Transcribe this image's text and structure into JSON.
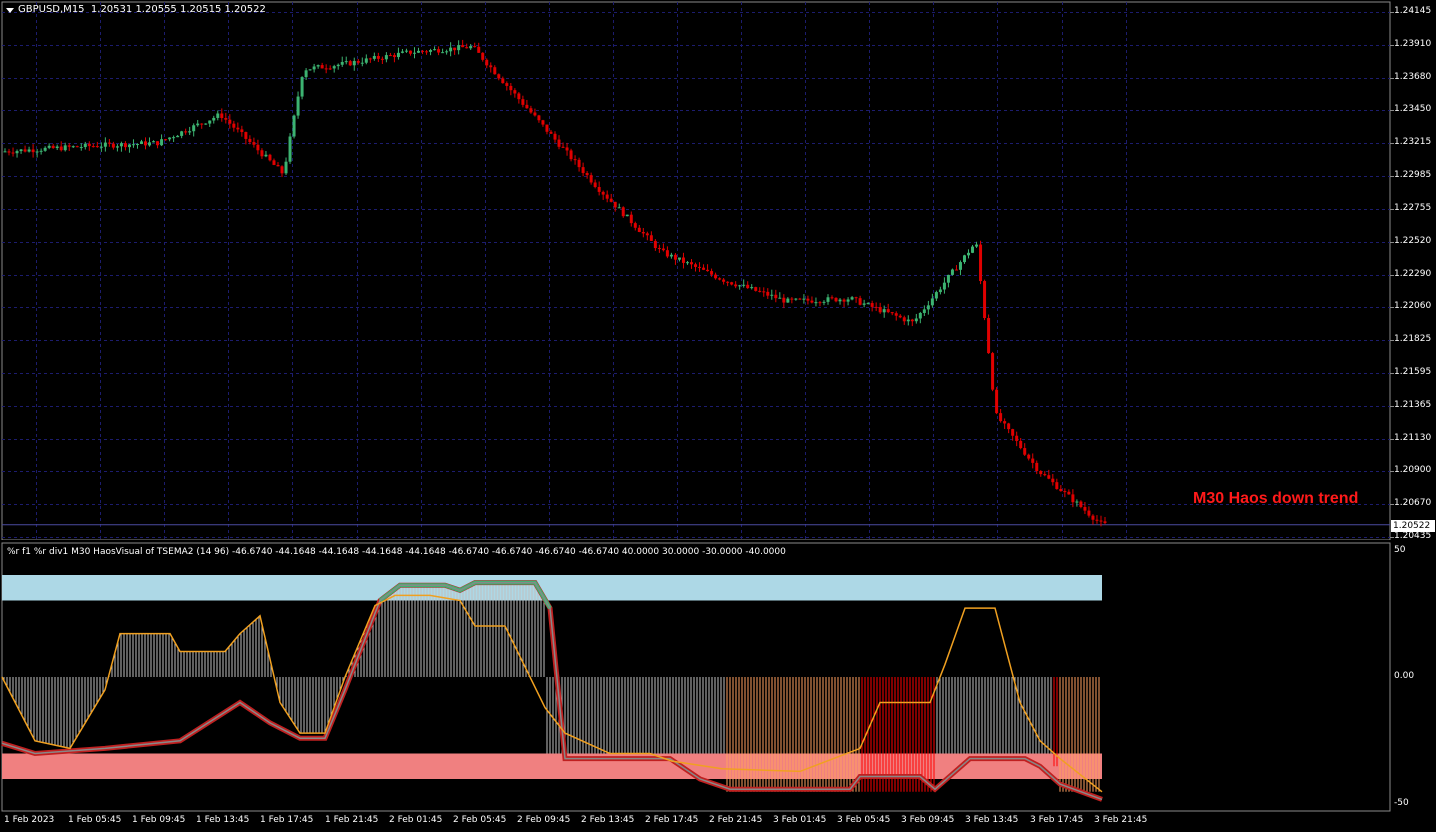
{
  "main_title": {
    "symbol": "GBPUSD,M15",
    "ohlc": "1.20531 1.20555 1.20515 1.20522"
  },
  "indicator_title": "%r f1 %r div1 M30 HaosVisual of TSEMA2 (14 96) -46.6740 -44.1648 -44.1648 -44.1648 -44.1648 -46.6740 -46.6740 -46.6740 -46.6740 40.0000 30.0000 -30.0000 -40.0000",
  "annotation": "M30 Haos down trend",
  "current_price": "1.20522",
  "price_axis": [
    "1.24145",
    "1.23910",
    "1.23680",
    "1.23450",
    "1.23215",
    "1.22985",
    "1.22755",
    "1.22520",
    "1.22290",
    "1.22060",
    "1.21825",
    "1.21595",
    "1.21365",
    "1.21130",
    "1.20900",
    "1.20670",
    "1.20435"
  ],
  "indicator_axis": [
    "50",
    "0.00",
    "-50"
  ],
  "time_axis": [
    "1 Feb 2023",
    "1 Feb 05:45",
    "1 Feb 09:45",
    "1 Feb 13:45",
    "1 Feb 17:45",
    "1 Feb 21:45",
    "2 Feb 01:45",
    "2 Feb 05:45",
    "2 Feb 09:45",
    "2 Feb 13:45",
    "2 Feb 17:45",
    "2 Feb 21:45",
    "3 Feb 01:45",
    "3 Feb 05:45",
    "3 Feb 09:45",
    "3 Feb 13:45",
    "3 Feb 17:45",
    "3 Feb 21:45"
  ],
  "colors": {
    "background": "#000000",
    "grid": "#1c1c6e",
    "bull_candle": "#3cb371",
    "bear_candle": "#e00000",
    "upper_band": "#add8e6",
    "lower_band": "#f08080",
    "histogram_neutral": "#c0c0c0",
    "histogram_orange": "#ffa060",
    "histogram_red": "#ff0000",
    "line_orange": "#f0a020",
    "line_green": "#3cb371",
    "line_dark_red": "#c02020"
  },
  "chart_data": {
    "type": "candlestick",
    "symbol": "GBPUSD",
    "timeframe": "M15",
    "y_range": [
      1.20435,
      1.24145
    ],
    "price_path_keypoints": [
      [
        "1 Feb 00:00",
        1.2316
      ],
      [
        "1 Feb 05:45",
        1.232
      ],
      [
        "1 Feb 09:45",
        1.2322
      ],
      [
        "1 Feb 13:45",
        1.2342
      ],
      [
        "1 Feb 17:45",
        1.23
      ],
      [
        "1 Feb 19:00",
        1.2374
      ],
      [
        "1 Feb 21:45",
        1.2378
      ],
      [
        "2 Feb 01:45",
        1.2386
      ],
      [
        "2 Feb 05:45",
        1.239
      ],
      [
        "2 Feb 09:45",
        1.234
      ],
      [
        "2 Feb 13:45",
        1.229
      ],
      [
        "2 Feb 17:45",
        1.2245
      ],
      [
        "2 Feb 21:45",
        1.2225
      ],
      [
        "3 Feb 01:45",
        1.221
      ],
      [
        "3 Feb 05:45",
        1.2212
      ],
      [
        "3 Feb 09:45",
        1.2195
      ],
      [
        "3 Feb 13:45",
        1.2252
      ],
      [
        "3 Feb 15:00",
        1.213
      ],
      [
        "3 Feb 17:45",
        1.209
      ],
      [
        "3 Feb 21:45",
        1.20522
      ]
    ],
    "indicator": {
      "y_range": [
        -50,
        50
      ],
      "levels": [
        40,
        30,
        -30,
        -40
      ]
    }
  }
}
